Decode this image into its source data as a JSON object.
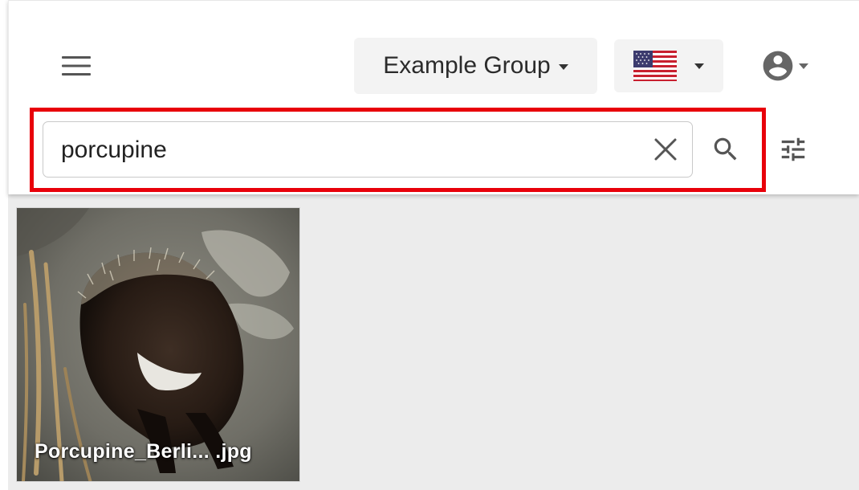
{
  "header": {
    "menu_icon": "hamburger-menu-icon",
    "group_selector": {
      "label": "Example Group",
      "icon": "caret-down-icon"
    },
    "language_selector": {
      "flag_icon": "us-flag-icon",
      "icon": "caret-down-icon"
    },
    "user_menu": {
      "icon": "account-circle-icon"
    }
  },
  "search": {
    "value": "porcupine",
    "clear_icon": "close-icon",
    "search_icon": "search-icon",
    "filter_icon": "filter-sliders-icon",
    "highlight_color": "#e8000a"
  },
  "results": {
    "items": [
      {
        "caption": "Porcupine_Berli... .jpg"
      }
    ]
  }
}
